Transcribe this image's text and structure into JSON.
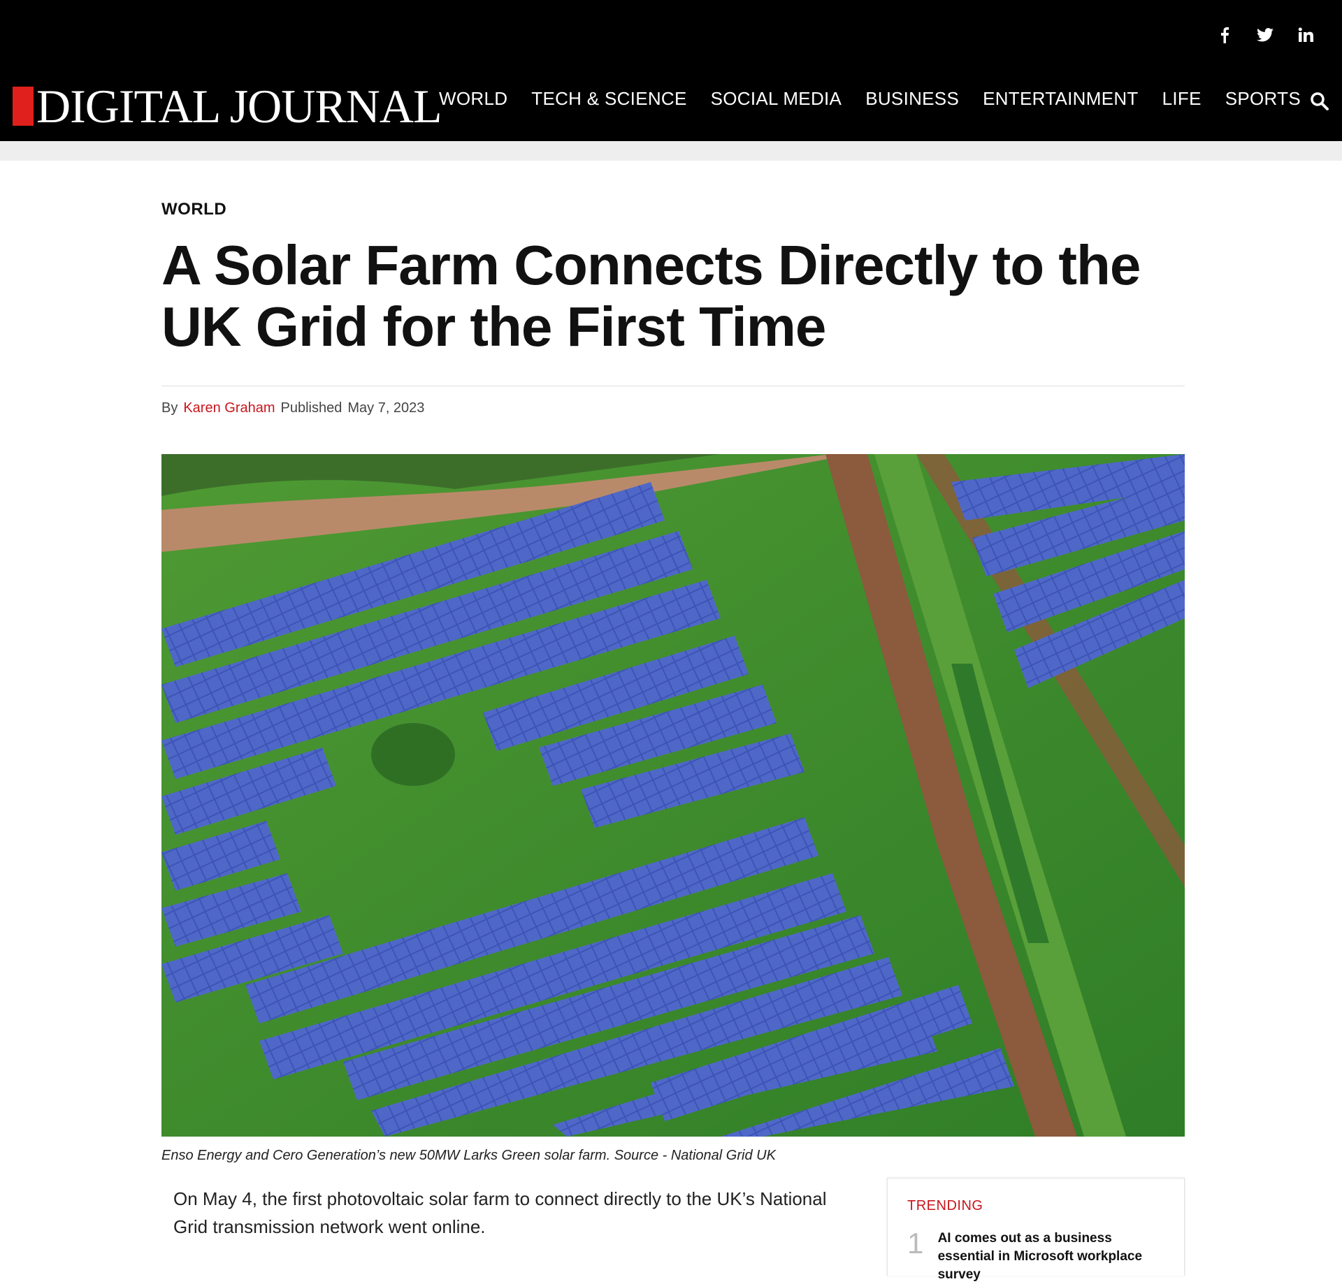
{
  "site": {
    "logo_text": "DIGITAL JOURNAL"
  },
  "social": {
    "icons": [
      "facebook-icon",
      "twitter-icon",
      "linkedin-icon"
    ]
  },
  "nav": {
    "items": [
      "WORLD",
      "TECH & SCIENCE",
      "SOCIAL MEDIA",
      "BUSINESS",
      "ENTERTAINMENT",
      "LIFE",
      "SPORTS"
    ]
  },
  "article": {
    "category": "WORLD",
    "title": "A Solar Farm Connects Directly to the UK Grid for the First Time",
    "by_label": "By",
    "author": "Karen Graham",
    "published_label": "Published",
    "date": "May 7, 2023",
    "caption": "Enso Energy and Cero Generation’s new 50MW Larks Green solar farm. Source - National Grid UK",
    "first_paragraph": "On May 4, the first photovoltaic solar farm to connect directly to the UK’s National Grid transmission network went online."
  },
  "trending": {
    "label": "TRENDING",
    "items": [
      {
        "number": "1",
        "title": "AI comes out as a business essential in Microsoft workplace survey"
      }
    ]
  },
  "colors": {
    "accent": "#c8161d",
    "header_bg": "#000000"
  }
}
